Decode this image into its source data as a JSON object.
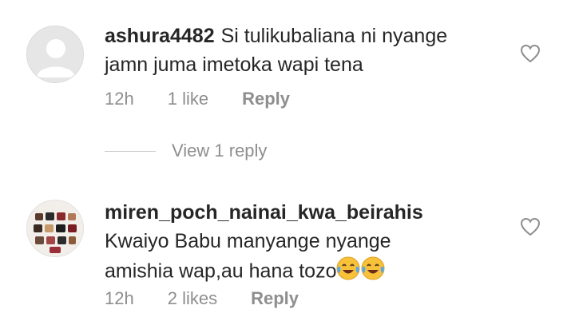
{
  "comments": [
    {
      "username": "ashura4482",
      "text_line1": "Si tulikubaliana ni nyange",
      "text_line2": "jamn juma imetoka wapi tena",
      "time": "12h",
      "likes": "1 like",
      "reply": "Reply",
      "avatar": "default-avatar-icon"
    },
    {
      "username": "miren_poch_nainai_kwa_beirahis",
      "text_line1": "Kwaiyo Babu manyange nyange",
      "text_line2": "amishia wap,au hana tozo",
      "emoji": "face-with-tears-of-joy x2",
      "time": "12h",
      "likes": "2 likes",
      "reply": "Reply",
      "avatar": "handbag-photo-avatar"
    }
  ],
  "view_replies": "View 1 reply",
  "colors": {
    "text": "#262626",
    "muted": "#8e8e8e",
    "background": "#ffffff"
  }
}
